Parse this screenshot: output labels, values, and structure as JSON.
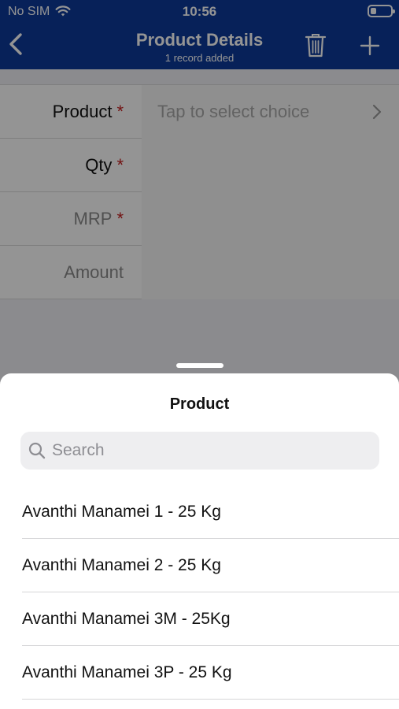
{
  "status_bar": {
    "carrier": "No SIM",
    "time": "10:56"
  },
  "nav": {
    "title": "Product Details",
    "subtitle": "1 record added",
    "back_icon": "chevron-left-icon",
    "delete_icon": "trash-icon",
    "add_icon": "plus-icon"
  },
  "form": {
    "fields": [
      {
        "label": "Product",
        "required": "*",
        "placeholder": "Tap to select choice"
      },
      {
        "label": "Qty",
        "required": "*"
      },
      {
        "label": "MRP",
        "required": "*"
      },
      {
        "label": "Amount"
      }
    ]
  },
  "sheet": {
    "title": "Product",
    "search_placeholder": "Search",
    "items": [
      {
        "label": "Avanthi Manamei 1 - 25 Kg"
      },
      {
        "label": "Avanthi Manamei 2 - 25 Kg"
      },
      {
        "label": "Avanthi Manamei 3M - 25Kg"
      },
      {
        "label": "Avanthi Manamei 3P - 25 Kg"
      }
    ]
  },
  "colors": {
    "header": "#0d3a9a",
    "required": "#c41e1e"
  }
}
